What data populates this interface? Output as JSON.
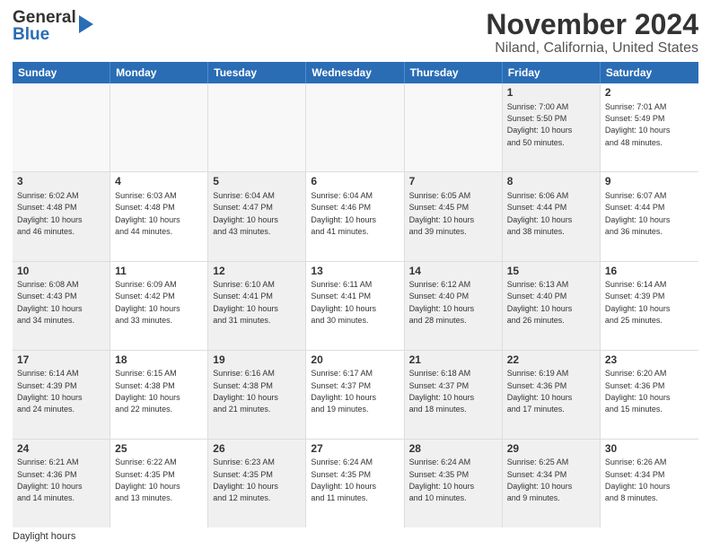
{
  "header": {
    "logo_general": "General",
    "logo_blue": "Blue",
    "main_title": "November 2024",
    "subtitle": "Niland, California, United States"
  },
  "calendar": {
    "days_of_week": [
      "Sunday",
      "Monday",
      "Tuesday",
      "Wednesday",
      "Thursday",
      "Friday",
      "Saturday"
    ],
    "weeks": [
      [
        {
          "day": "",
          "info": "",
          "empty": true
        },
        {
          "day": "",
          "info": "",
          "empty": true
        },
        {
          "day": "",
          "info": "",
          "empty": true
        },
        {
          "day": "",
          "info": "",
          "empty": true
        },
        {
          "day": "",
          "info": "",
          "empty": true
        },
        {
          "day": "1",
          "info": "Sunrise: 7:00 AM\nSunset: 5:50 PM\nDaylight: 10 hours\nand 50 minutes.",
          "shaded": true
        },
        {
          "day": "2",
          "info": "Sunrise: 7:01 AM\nSunset: 5:49 PM\nDaylight: 10 hours\nand 48 minutes."
        }
      ],
      [
        {
          "day": "3",
          "info": "Sunrise: 6:02 AM\nSunset: 4:48 PM\nDaylight: 10 hours\nand 46 minutes.",
          "shaded": true
        },
        {
          "day": "4",
          "info": "Sunrise: 6:03 AM\nSunset: 4:48 PM\nDaylight: 10 hours\nand 44 minutes."
        },
        {
          "day": "5",
          "info": "Sunrise: 6:04 AM\nSunset: 4:47 PM\nDaylight: 10 hours\nand 43 minutes.",
          "shaded": true
        },
        {
          "day": "6",
          "info": "Sunrise: 6:04 AM\nSunset: 4:46 PM\nDaylight: 10 hours\nand 41 minutes."
        },
        {
          "day": "7",
          "info": "Sunrise: 6:05 AM\nSunset: 4:45 PM\nDaylight: 10 hours\nand 39 minutes.",
          "shaded": true
        },
        {
          "day": "8",
          "info": "Sunrise: 6:06 AM\nSunset: 4:44 PM\nDaylight: 10 hours\nand 38 minutes.",
          "shaded": true
        },
        {
          "day": "9",
          "info": "Sunrise: 6:07 AM\nSunset: 4:44 PM\nDaylight: 10 hours\nand 36 minutes."
        }
      ],
      [
        {
          "day": "10",
          "info": "Sunrise: 6:08 AM\nSunset: 4:43 PM\nDaylight: 10 hours\nand 34 minutes.",
          "shaded": true
        },
        {
          "day": "11",
          "info": "Sunrise: 6:09 AM\nSunset: 4:42 PM\nDaylight: 10 hours\nand 33 minutes."
        },
        {
          "day": "12",
          "info": "Sunrise: 6:10 AM\nSunset: 4:41 PM\nDaylight: 10 hours\nand 31 minutes.",
          "shaded": true
        },
        {
          "day": "13",
          "info": "Sunrise: 6:11 AM\nSunset: 4:41 PM\nDaylight: 10 hours\nand 30 minutes."
        },
        {
          "day": "14",
          "info": "Sunrise: 6:12 AM\nSunset: 4:40 PM\nDaylight: 10 hours\nand 28 minutes.",
          "shaded": true
        },
        {
          "day": "15",
          "info": "Sunrise: 6:13 AM\nSunset: 4:40 PM\nDaylight: 10 hours\nand 26 minutes.",
          "shaded": true
        },
        {
          "day": "16",
          "info": "Sunrise: 6:14 AM\nSunset: 4:39 PM\nDaylight: 10 hours\nand 25 minutes."
        }
      ],
      [
        {
          "day": "17",
          "info": "Sunrise: 6:14 AM\nSunset: 4:39 PM\nDaylight: 10 hours\nand 24 minutes.",
          "shaded": true
        },
        {
          "day": "18",
          "info": "Sunrise: 6:15 AM\nSunset: 4:38 PM\nDaylight: 10 hours\nand 22 minutes."
        },
        {
          "day": "19",
          "info": "Sunrise: 6:16 AM\nSunset: 4:38 PM\nDaylight: 10 hours\nand 21 minutes.",
          "shaded": true
        },
        {
          "day": "20",
          "info": "Sunrise: 6:17 AM\nSunset: 4:37 PM\nDaylight: 10 hours\nand 19 minutes."
        },
        {
          "day": "21",
          "info": "Sunrise: 6:18 AM\nSunset: 4:37 PM\nDaylight: 10 hours\nand 18 minutes.",
          "shaded": true
        },
        {
          "day": "22",
          "info": "Sunrise: 6:19 AM\nSunset: 4:36 PM\nDaylight: 10 hours\nand 17 minutes.",
          "shaded": true
        },
        {
          "day": "23",
          "info": "Sunrise: 6:20 AM\nSunset: 4:36 PM\nDaylight: 10 hours\nand 15 minutes."
        }
      ],
      [
        {
          "day": "24",
          "info": "Sunrise: 6:21 AM\nSunset: 4:36 PM\nDaylight: 10 hours\nand 14 minutes.",
          "shaded": true
        },
        {
          "day": "25",
          "info": "Sunrise: 6:22 AM\nSunset: 4:35 PM\nDaylight: 10 hours\nand 13 minutes."
        },
        {
          "day": "26",
          "info": "Sunrise: 6:23 AM\nSunset: 4:35 PM\nDaylight: 10 hours\nand 12 minutes.",
          "shaded": true
        },
        {
          "day": "27",
          "info": "Sunrise: 6:24 AM\nSunset: 4:35 PM\nDaylight: 10 hours\nand 11 minutes."
        },
        {
          "day": "28",
          "info": "Sunrise: 6:24 AM\nSunset: 4:35 PM\nDaylight: 10 hours\nand 10 minutes.",
          "shaded": true
        },
        {
          "day": "29",
          "info": "Sunrise: 6:25 AM\nSunset: 4:34 PM\nDaylight: 10 hours\nand 9 minutes.",
          "shaded": true
        },
        {
          "day": "30",
          "info": "Sunrise: 6:26 AM\nSunset: 4:34 PM\nDaylight: 10 hours\nand 8 minutes."
        }
      ]
    ]
  },
  "footer": {
    "daylight_hours_label": "Daylight hours"
  }
}
